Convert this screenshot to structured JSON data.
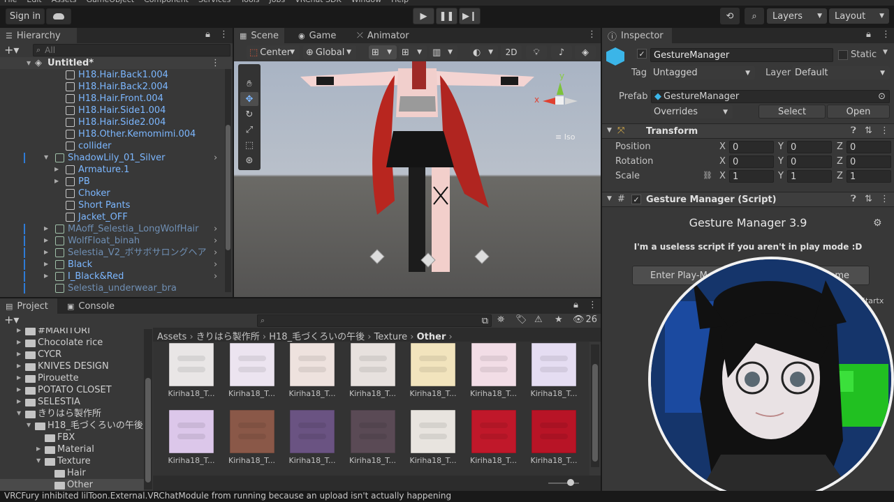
{
  "menubar": {
    "items": [
      "File",
      "Edit",
      "Assets",
      "GameObject",
      "Component",
      "Services",
      "Tools",
      "Jobs",
      "VRChat SDK",
      "Window",
      "Help"
    ]
  },
  "toolbar": {
    "sign_in": "Sign in",
    "layers": "Layers",
    "layout": "Layout"
  },
  "hierarchy": {
    "tab": "Hierarchy",
    "search_placeholder": "All",
    "scene": "Untitled*",
    "items": [
      {
        "label": "H18.Hair.Back1.004",
        "style": "blue"
      },
      {
        "label": "H18.Hair.Back2.004",
        "style": "blue"
      },
      {
        "label": "H18.Hair.Front.004",
        "style": "blue"
      },
      {
        "label": "H18.Hair.Side1.004",
        "style": "blue"
      },
      {
        "label": "H18.Hair.Side2.004",
        "style": "blue"
      },
      {
        "label": "H18.Other.Kemomimi.004",
        "style": "blue"
      },
      {
        "label": "collider",
        "style": "blue"
      },
      {
        "label": "ShadowLily_01_Silver",
        "style": "blue"
      },
      {
        "label": "Armature.1",
        "style": "blue"
      },
      {
        "label": "PB",
        "style": "blue"
      },
      {
        "label": "Choker",
        "style": "blue"
      },
      {
        "label": "Short Pants",
        "style": "blue"
      },
      {
        "label": "Jacket_OFF",
        "style": "blue"
      },
      {
        "label": "MAoff_Selestia_LongWolfHair",
        "style": "dim"
      },
      {
        "label": "WolfFloat_binah",
        "style": "dim"
      },
      {
        "label": "Selestia_V2_ボサボサロングヘア",
        "style": "dim"
      },
      {
        "label": "Black",
        "style": "blue"
      },
      {
        "label": "I_Black&Red",
        "style": "blue"
      },
      {
        "label": "Selestia_underwear_bra",
        "style": "dim"
      }
    ]
  },
  "scene_view": {
    "tabs": [
      "Scene",
      "Game",
      "Animator"
    ],
    "pivot": "Center",
    "space": "Global",
    "mode_2d": "2D",
    "gizmo": {
      "y": "y",
      "x": "x",
      "persp": "Iso"
    }
  },
  "inspector": {
    "tab": "Inspector",
    "object_name": "GestureManager",
    "static_label": "Static",
    "tag_label": "Tag",
    "tag_value": "Untagged",
    "layer_label": "Layer",
    "layer_value": "Default",
    "prefab_label": "Prefab",
    "prefab_value": "GestureManager",
    "overrides": "Overrides",
    "select": "Select",
    "open": "Open",
    "transform": {
      "title": "Transform",
      "rows": [
        {
          "label": "Position",
          "x": "0",
          "y": "0",
          "z": "0"
        },
        {
          "label": "Rotation",
          "x": "0",
          "y": "0",
          "z": "0"
        },
        {
          "label": "Scale",
          "x": "1",
          "y": "1",
          "z": "1"
        }
      ],
      "axis_x": "X",
      "axis_y": "Y",
      "axis_z": "Z"
    },
    "script": {
      "title": "Gesture Manager (Script)",
      "heading": "Gesture Manager 3.9",
      "message": "I'm a useless script if you aren't in play mode :D",
      "button_left": "Enter Play-M",
      "button_right": "ame",
      "footnote": "Startx"
    }
  },
  "project": {
    "tabs": [
      "Project",
      "Console"
    ],
    "count": "26",
    "tree": [
      {
        "label": "#MARITORI",
        "indent": 0,
        "open": false
      },
      {
        "label": "Chocolate rice",
        "indent": 0,
        "open": false
      },
      {
        "label": "CYCR",
        "indent": 0,
        "open": false
      },
      {
        "label": "KNIVES DESIGN",
        "indent": 0,
        "open": false
      },
      {
        "label": "Pirouette",
        "indent": 0,
        "open": false
      },
      {
        "label": "POTATO CLOSET",
        "indent": 0,
        "open": false
      },
      {
        "label": "SELESTIA",
        "indent": 0,
        "open": false
      },
      {
        "label": "きりはら製作所",
        "indent": 0,
        "open": true
      },
      {
        "label": "H18_毛づくろいの午後",
        "indent": 1,
        "open": true
      },
      {
        "label": "FBX",
        "indent": 2,
        "open": null
      },
      {
        "label": "Material",
        "indent": 2,
        "open": false
      },
      {
        "label": "Texture",
        "indent": 2,
        "open": true
      },
      {
        "label": "Hair",
        "indent": 3,
        "open": null
      },
      {
        "label": "Other",
        "indent": 3,
        "open": null
      }
    ],
    "breadcrumb": [
      "Assets",
      "きりはら製作所",
      "H18_毛づくろいの午後",
      "Texture",
      "Other"
    ],
    "assets": [
      {
        "label": "Kiriha18_T...",
        "color": "#e9e6e6"
      },
      {
        "label": "Kiriha18_T...",
        "color": "#ece4f0"
      },
      {
        "label": "Kiriha18_T...",
        "color": "#eee2de"
      },
      {
        "label": "Kiriha18_T...",
        "color": "#e7e1de"
      },
      {
        "label": "Kiriha18_T...",
        "color": "#f2e4bd"
      },
      {
        "label": "Kiriha18_T...",
        "color": "#f2dde6"
      },
      {
        "label": "Kiriha18_T...",
        "color": "#e5ddf2"
      },
      {
        "label": "Kiriha18_T...",
        "color": "#dcc7ea"
      },
      {
        "label": "Kiriha18_T...",
        "color": "#8a5848"
      },
      {
        "label": "Kiriha18_T...",
        "color": "#6a5382"
      },
      {
        "label": "Kiriha18_T...",
        "color": "#5a4a55"
      },
      {
        "label": "Kiriha18_T...",
        "color": "#e8e4df"
      },
      {
        "label": "Kiriha18_T...",
        "color": "#c0182a"
      },
      {
        "label": "Kiriha18_T...",
        "color": "#b81426"
      }
    ]
  },
  "status": {
    "message": "VRCFury inhibited lilToon.External.VRChatModule from running because an upload isn't actually happening"
  },
  "colors": {
    "accent": "#7cb7ff",
    "panel": "#383838",
    "dark": "#191919"
  }
}
